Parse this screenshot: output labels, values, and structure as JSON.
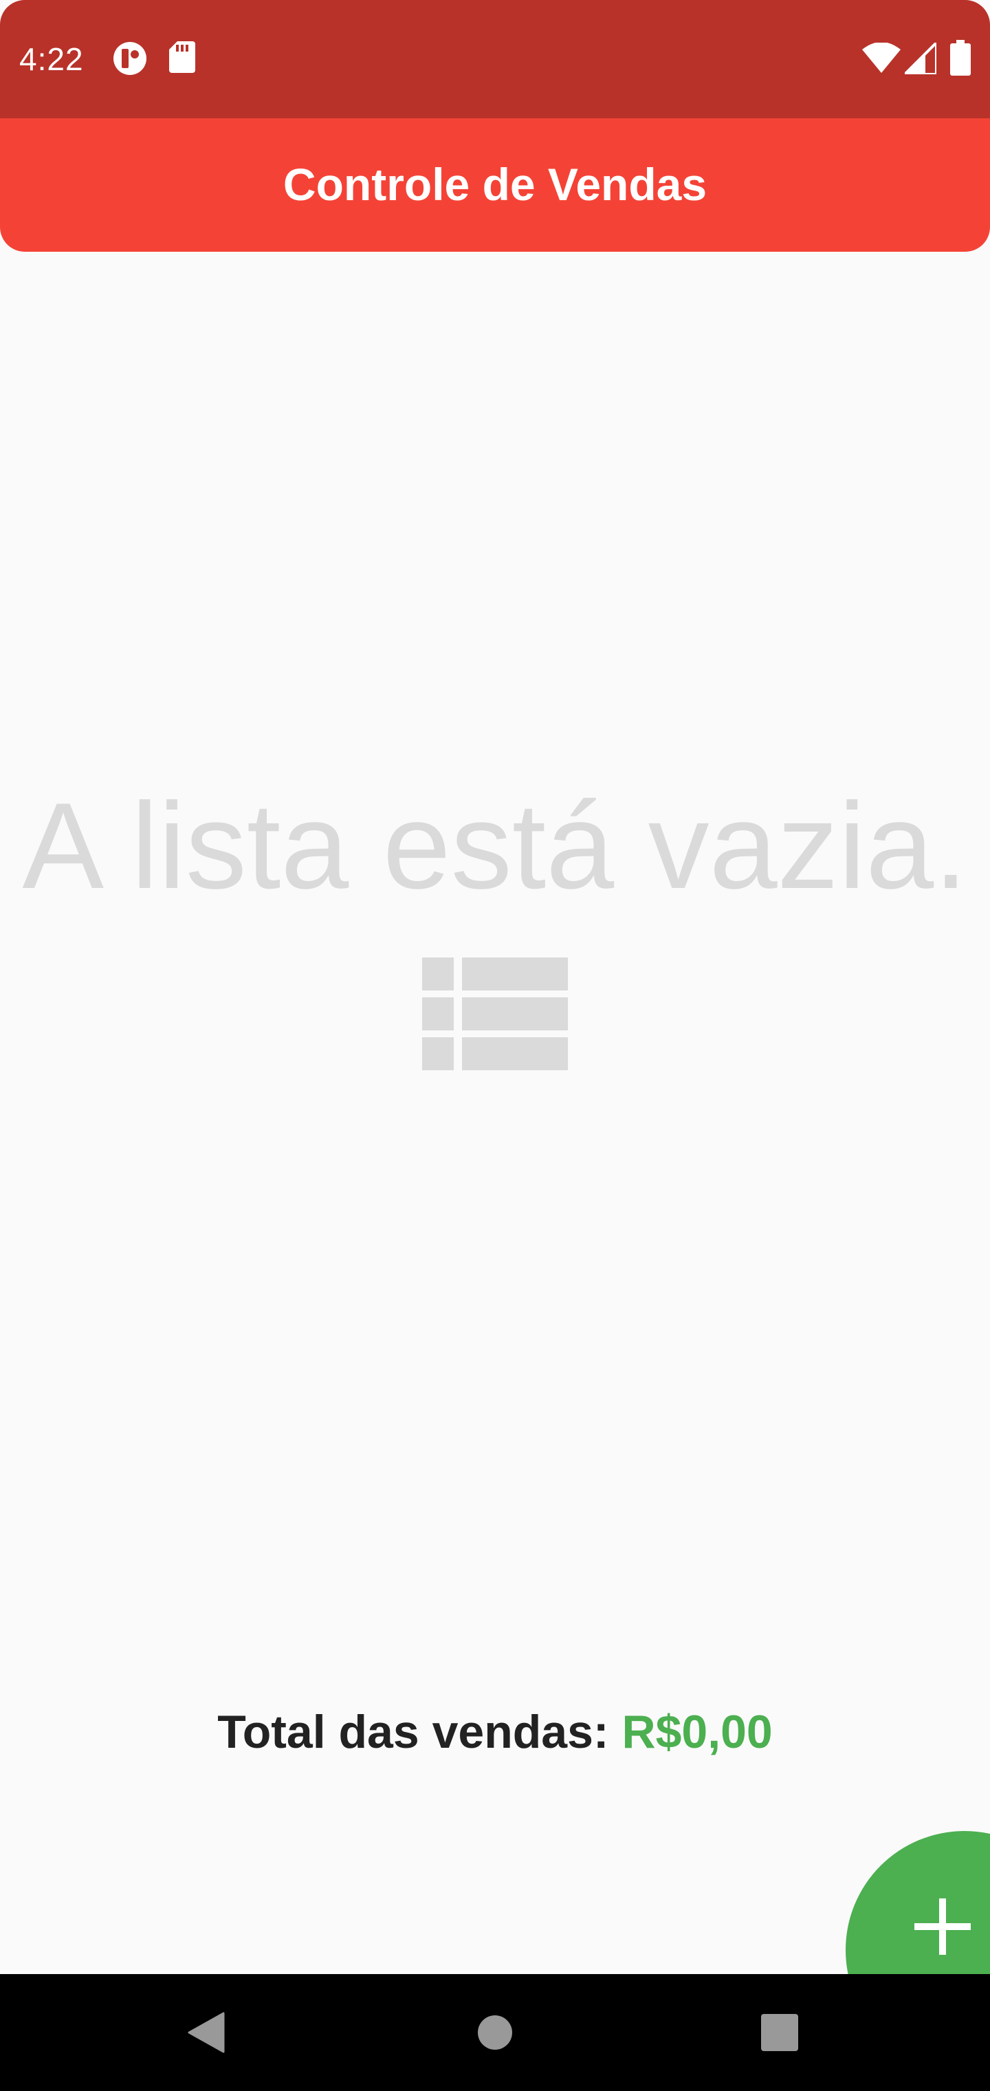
{
  "status_bar": {
    "time": "4:22",
    "icons_left": [
      "data-saver-icon",
      "sd-card-icon"
    ],
    "icons_right": [
      "wifi-icon",
      "cellular-signal-icon",
      "battery-icon"
    ]
  },
  "app_bar": {
    "title": "Controle de Vendas",
    "color": "#f44336"
  },
  "empty_state": {
    "message": "A lista está vazia.",
    "icon": "list-icon"
  },
  "totals": {
    "label": "Total das vendas: ",
    "value": "R$0,00",
    "value_color": "#4caf50"
  },
  "fab": {
    "icon": "add-icon",
    "color": "#4caf50"
  },
  "nav_bar": {
    "buttons": [
      "back-icon",
      "home-icon",
      "recents-icon"
    ]
  }
}
